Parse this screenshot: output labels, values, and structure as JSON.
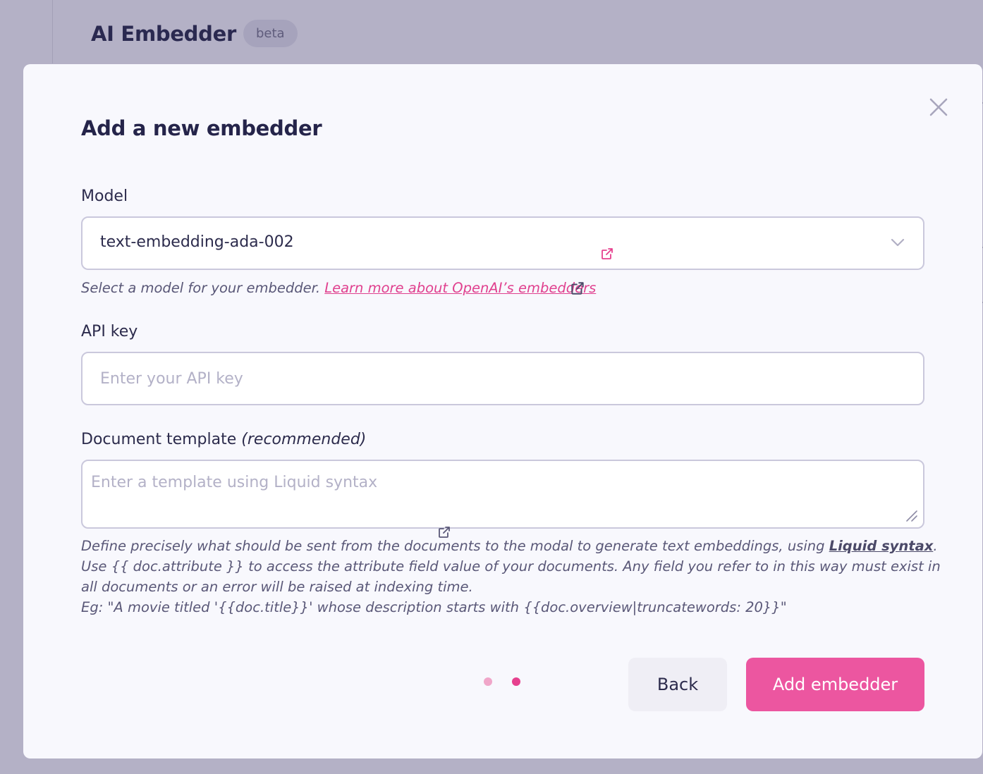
{
  "background": {
    "title": "AI Embedder",
    "badge": "beta"
  },
  "modal": {
    "title": "Add a new embedder",
    "model": {
      "label": "Model",
      "value": "text-embedding-ada-002",
      "helper_text": "Select a model for your embedder. ",
      "helper_link": "Learn more about OpenAI’s embedders"
    },
    "api_key": {
      "label": "API key",
      "placeholder": "Enter your API key",
      "value": ""
    },
    "template": {
      "label": "Document template ",
      "label_note": "(recommended)",
      "placeholder": "Enter a template using Liquid syntax",
      "value": "",
      "help_1": "Define precisely what should be sent from the documents to the modal to generate text embeddings, using ",
      "help_link": "Liquid syntax",
      "help_2": ".",
      "help_3": "Use {{ doc.attribute }} to access the attribute field value of your documents. Any field you refer to in this way must exist in all documents or an error will be raised at indexing time.",
      "help_4": "Eg: \"A movie titled '{{doc.title}}' whose description starts with {{doc.overview|truncatewords: 20}}\""
    },
    "steps": {
      "current": 2,
      "total": 2
    },
    "back_label": "Back",
    "submit_label": "Add embedder"
  },
  "colors": {
    "accent": "#ec56a0",
    "link": "#e0418f",
    "backdrop": "#b4b1c6",
    "modal_bg": "#f8f8fd"
  },
  "icons": [
    "close-icon",
    "chevron-down-icon",
    "external-link-icon",
    "resize-handle-icon"
  ]
}
